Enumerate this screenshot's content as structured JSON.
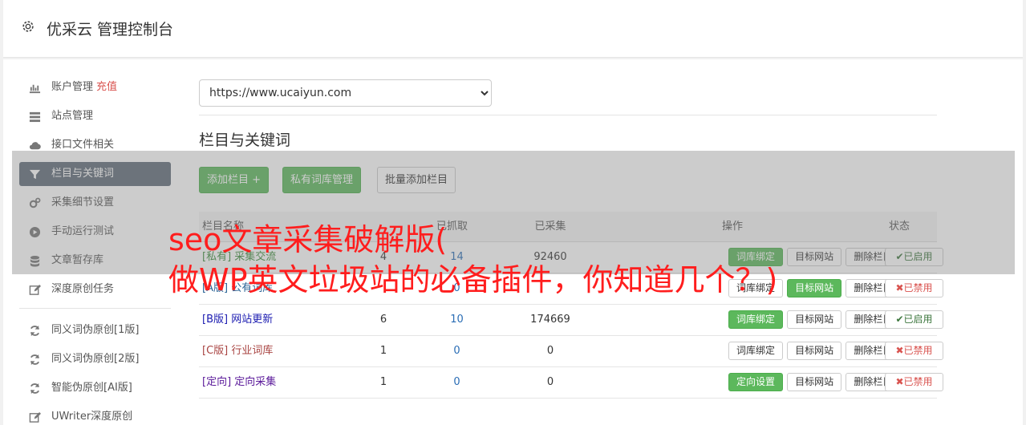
{
  "header": {
    "title": "优采云 管理控制台"
  },
  "sidebar": {
    "items": [
      {
        "label": "账户管理",
        "extra": "充值",
        "icon": "bar-chart-icon"
      },
      {
        "label": "站点管理",
        "icon": "server-icon"
      },
      {
        "label": "接口文件相关",
        "icon": "cloud-upload-icon"
      },
      {
        "label": "栏目与关键词",
        "icon": "filter-icon",
        "active": true
      },
      {
        "label": "采集细节设置",
        "icon": "cogs-icon"
      },
      {
        "label": "手动运行测试",
        "icon": "play-circle-icon"
      },
      {
        "label": "文章暂存库",
        "icon": "database-icon"
      },
      {
        "label": "深度原创任务",
        "icon": "edit-icon"
      }
    ],
    "items2": [
      {
        "label": "同义词伪原创[1版]",
        "icon": "refresh-icon"
      },
      {
        "label": "同义词伪原创[2版]",
        "icon": "refresh-icon"
      },
      {
        "label": "智能伪原创[AI版]",
        "icon": "refresh-icon"
      },
      {
        "label": "UWriter深度原创",
        "icon": "edit-icon"
      }
    ]
  },
  "site_select": {
    "value": "https://www.ucaiyun.com"
  },
  "section": {
    "title": "栏目与关键词"
  },
  "toolbar": {
    "add_column": "添加栏目 +",
    "private_lib": "私有词库管理",
    "batch_add": "批量添加栏目"
  },
  "table": {
    "headers": [
      "栏目名称",
      "",
      "已抓取",
      "已采集",
      "操作",
      "状态"
    ],
    "rows": [
      {
        "tag": "[私有]",
        "name": "采集交流",
        "a": "4",
        "b": "14",
        "c": "92460",
        "op1": "词库绑定",
        "op2": "目标网站",
        "op3": "删除栏目",
        "status": "已启用"
      },
      {
        "tag": "[A版]",
        "name": "公有词库",
        "a": "",
        "b": "0",
        "c": "",
        "op1": "词库绑定",
        "op2": "目标网站",
        "op3": "删除栏目",
        "status": "已禁用"
      },
      {
        "tag": "[B版]",
        "name": "网站更新",
        "a": "6",
        "b": "10",
        "c": "174669",
        "op1": "词库绑定",
        "op2": "目标网站",
        "op3": "删除栏目",
        "status": "已启用"
      },
      {
        "tag": "[C版]",
        "name": "行业词库",
        "a": "1",
        "b": "0",
        "c": "0",
        "op1": "词库绑定",
        "op2": "目标网站",
        "op3": "删除栏目",
        "status": "已禁用"
      },
      {
        "tag": "[定向]",
        "name": "定向采集",
        "a": "1",
        "b": "0",
        "c": "0",
        "op1": "定向设置",
        "op2": "目标网站",
        "op3": "删除栏目",
        "status": "已禁用"
      }
    ]
  },
  "overlay": {
    "line1": "seo文章采集破解版(",
    "line2": "做WP英文垃圾站的必备插件，你知道几个？)"
  },
  "colors": {
    "accent": "#5cb85c",
    "active_nav": "#606c79",
    "danger": "#d9534f",
    "overlay_text": "#ff1d1d"
  }
}
